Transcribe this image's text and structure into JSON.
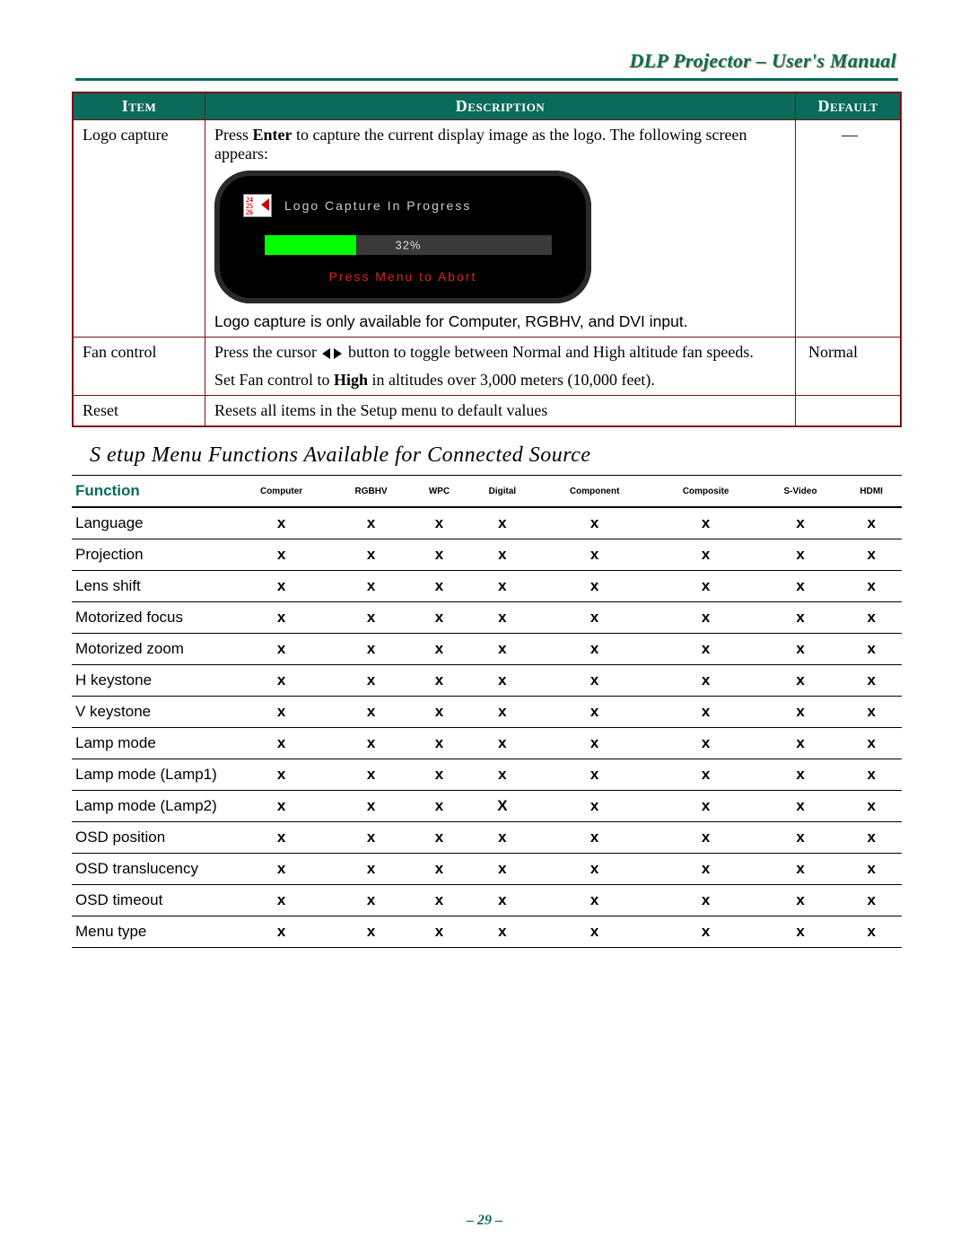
{
  "header": {
    "title": "DLP Projector – User's Manual"
  },
  "page_number": "– 29 –",
  "table1": {
    "head": {
      "item": "Item",
      "description": "Description",
      "default": "Default"
    },
    "rows": [
      {
        "item": "Logo capture",
        "desc_pre": "Press ",
        "desc_enter": "Enter",
        "desc_post": " to capture the current display image as the logo. The following screen appears:",
        "osd": {
          "title": "Logo Capture In Progress",
          "percent": "32%",
          "abort": "Press Menu to Abort"
        },
        "note": "Logo capture is only available for Computer, RGBHV, and DVI input.",
        "default": "—"
      },
      {
        "item": "Fan control",
        "desc_line1_pre": "Press the cursor ",
        "desc_line1_post": " button to toggle between Normal and High altitude fan speeds.",
        "desc_line2_pre": "Set Fan control to ",
        "desc_line2_bold": "High",
        "desc_line2_post": " in altitudes over 3,000 meters (10,000 feet).",
        "default": "Normal"
      },
      {
        "item": "Reset",
        "desc": "Resets all items in the Setup menu to default values",
        "default": ""
      }
    ]
  },
  "section_title": "S  etup Menu Functions Available for Connected Source",
  "table2": {
    "head": {
      "function": "Function",
      "sources": [
        "Computer",
        "RGBHV",
        "WPC",
        "Digital",
        "Component",
        "Composite",
        "S-Video",
        "HDMI"
      ]
    },
    "rows": [
      {
        "fn": "Language",
        "v": [
          "x",
          "x",
          "x",
          "x",
          "x",
          "x",
          "x",
          "x"
        ]
      },
      {
        "fn": "Projection",
        "v": [
          "x",
          "x",
          "x",
          "x",
          "x",
          "x",
          "x",
          "x"
        ]
      },
      {
        "fn": "Lens shift",
        "v": [
          "x",
          "x",
          "x",
          "x",
          "x",
          "x",
          "x",
          "x"
        ]
      },
      {
        "fn": "Motorized focus",
        "v": [
          "x",
          "x",
          "x",
          "x",
          "x",
          "x",
          "x",
          "x"
        ]
      },
      {
        "fn": "Motorized zoom",
        "v": [
          "x",
          "x",
          "x",
          "x",
          "x",
          "x",
          "x",
          "x"
        ]
      },
      {
        "fn": "H keystone",
        "v": [
          "x",
          "x",
          "x",
          "x",
          "x",
          "x",
          "x",
          "x"
        ]
      },
      {
        "fn": "V keystone",
        "v": [
          "x",
          "x",
          "x",
          "x",
          "x",
          "x",
          "x",
          "x"
        ]
      },
      {
        "fn": "Lamp mode",
        "v": [
          "x",
          "x",
          "x",
          "x",
          "x",
          "x",
          "x",
          "x"
        ]
      },
      {
        "fn": "Lamp mode (Lamp1)",
        "v": [
          "x",
          "x",
          "x",
          "x",
          "x",
          "x",
          "x",
          "x"
        ]
      },
      {
        "fn": "Lamp mode (Lamp2)",
        "v": [
          "x",
          "x",
          "x",
          "X",
          "x",
          "x",
          "x",
          "x"
        ]
      },
      {
        "fn": "OSD position",
        "v": [
          "x",
          "x",
          "x",
          "x",
          "x",
          "x",
          "x",
          "x"
        ]
      },
      {
        "fn": "OSD translucency",
        "v": [
          "x",
          "x",
          "x",
          "x",
          "x",
          "x",
          "x",
          "x"
        ]
      },
      {
        "fn": "OSD timeout",
        "v": [
          "x",
          "x",
          "x",
          "x",
          "x",
          "x",
          "x",
          "x"
        ]
      },
      {
        "fn": "Menu type",
        "v": [
          "x",
          "x",
          "x",
          "x",
          "x",
          "x",
          "x",
          "x"
        ]
      }
    ]
  }
}
